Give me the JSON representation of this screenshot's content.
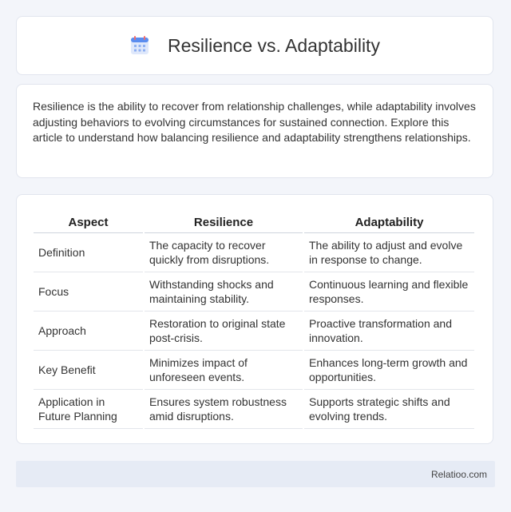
{
  "header": {
    "title": "Resilience vs. Adaptability",
    "icon": "calendar-icon"
  },
  "intro": {
    "text": "Resilience is the ability to recover from relationship challenges, while adaptability involves adjusting behaviors to evolving circumstances for sustained connection. Explore this article to understand how balancing resilience and adaptability strengthens relationships."
  },
  "table": {
    "headers": [
      "Aspect",
      "Resilience",
      "Adaptability"
    ],
    "rows": [
      [
        "Definition",
        "The capacity to recover quickly from disruptions.",
        "The ability to adjust and evolve in response to change."
      ],
      [
        "Focus",
        "Withstanding shocks and maintaining stability.",
        "Continuous learning and flexible responses."
      ],
      [
        "Approach",
        "Restoration to original state post-crisis.",
        "Proactive transformation and innovation."
      ],
      [
        "Key Benefit",
        "Minimizes impact of unforeseen events.",
        "Enhances long-term growth and opportunities."
      ],
      [
        "Application in Future Planning",
        "Ensures system robustness amid disruptions.",
        "Supports strategic shifts and evolving trends."
      ]
    ]
  },
  "footer": {
    "brand": "Relatioo.com"
  },
  "colors": {
    "icon_accent": "#5b8def",
    "icon_header": "#f26b6b"
  }
}
